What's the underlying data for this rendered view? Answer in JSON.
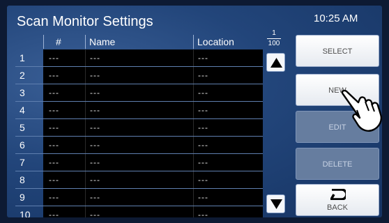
{
  "header": {
    "title": "Scan Monitor Settings",
    "clock": "10:25 AM"
  },
  "table": {
    "columns": [
      "#",
      "Name",
      "Location"
    ],
    "rows": [
      {
        "n": "1",
        "id": "---",
        "name": "---",
        "location": "---"
      },
      {
        "n": "2",
        "id": "---",
        "name": "---",
        "location": "---"
      },
      {
        "n": "3",
        "id": "---",
        "name": "---",
        "location": "---"
      },
      {
        "n": "4",
        "id": "---",
        "name": "---",
        "location": "---"
      },
      {
        "n": "5",
        "id": "---",
        "name": "---",
        "location": "---"
      },
      {
        "n": "6",
        "id": "---",
        "name": "---",
        "location": "---"
      },
      {
        "n": "7",
        "id": "---",
        "name": "---",
        "location": "---"
      },
      {
        "n": "8",
        "id": "---",
        "name": "---",
        "location": "---"
      },
      {
        "n": "9",
        "id": "---",
        "name": "---",
        "location": "---"
      },
      {
        "n": "10",
        "id": "---",
        "name": "---",
        "location": "---"
      }
    ]
  },
  "pager": {
    "current": "1",
    "total": "100"
  },
  "buttons": {
    "select": "SELECT",
    "new": "NEW",
    "edit": "EDIT",
    "delete": "DELETE",
    "back": "BACK"
  },
  "icons": {
    "scroll_up": "triangle-up-icon",
    "scroll_down": "triangle-down-icon",
    "back": "back-arrow-icon",
    "pointer": "hand-pointer-icon"
  },
  "colors": {
    "background": "#22457a",
    "cell": "#000000",
    "button": "#f5f7fa",
    "disabled_button": "#667d9f"
  }
}
